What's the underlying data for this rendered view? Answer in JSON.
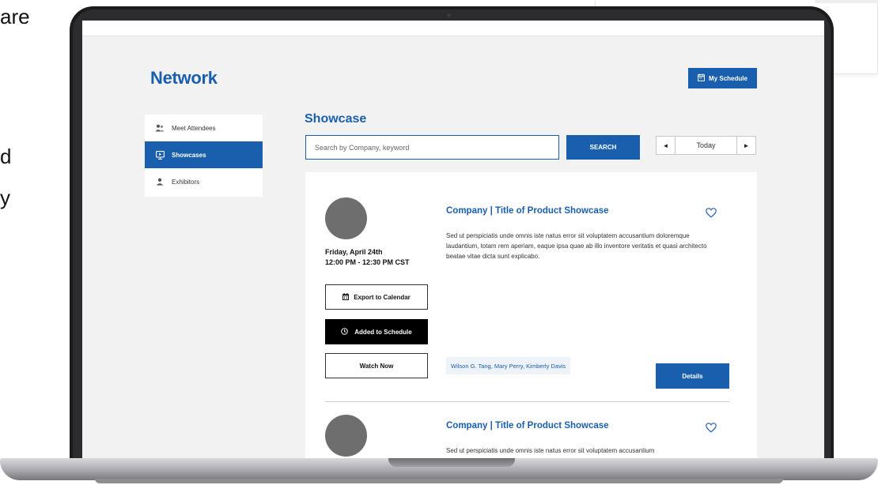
{
  "background": {
    "fragments": [
      "are",
      "d",
      "y"
    ]
  },
  "header": {
    "title": "Network",
    "my_schedule_label": "My Schedule"
  },
  "sidebar": {
    "items": [
      {
        "label": "Meet Attendees",
        "icon": "attendees-icon",
        "active": false
      },
      {
        "label": "Showcases",
        "icon": "showcase-icon",
        "active": true
      },
      {
        "label": "Exhibitors",
        "icon": "person-icon",
        "active": false
      }
    ]
  },
  "main": {
    "title": "Showcase",
    "search": {
      "placeholder": "Search by Company, keyword",
      "value": "",
      "button_label": "SEARCH"
    },
    "date_nav": {
      "label": "Today",
      "prev": "◄",
      "next": "►"
    }
  },
  "showcases": [
    {
      "title": "Company  |  Title of Product Showcase",
      "description": "Sed ut perspiciatis unde omnis iste natus error sit voluptatem accusantium doloremque laudantium, totam rem aperiam, eaque ipsa quae ab illo inventore veritatis et quasi architecto beatae vitae dicta sunt explicabo.",
      "date": "Friday, April 24th",
      "time": "12:00 PM - 12:30 PM CST",
      "export_label": "Export to Calendar",
      "added_label": "Added to Schedule",
      "watch_label": "Watch Now",
      "speakers": "Wilson G. Tang, Mary Perry, Kimberly Davis",
      "details_label": "Details"
    },
    {
      "title": "Company  |  Title of Product Showcase",
      "description": "Sed ut perspiciatis unde omnis iste natus error sit voluptatem accusantium"
    }
  ],
  "colors": {
    "accent": "#1a5fad",
    "background": "#f2f2f2",
    "avatar": "#6e6e6e"
  }
}
